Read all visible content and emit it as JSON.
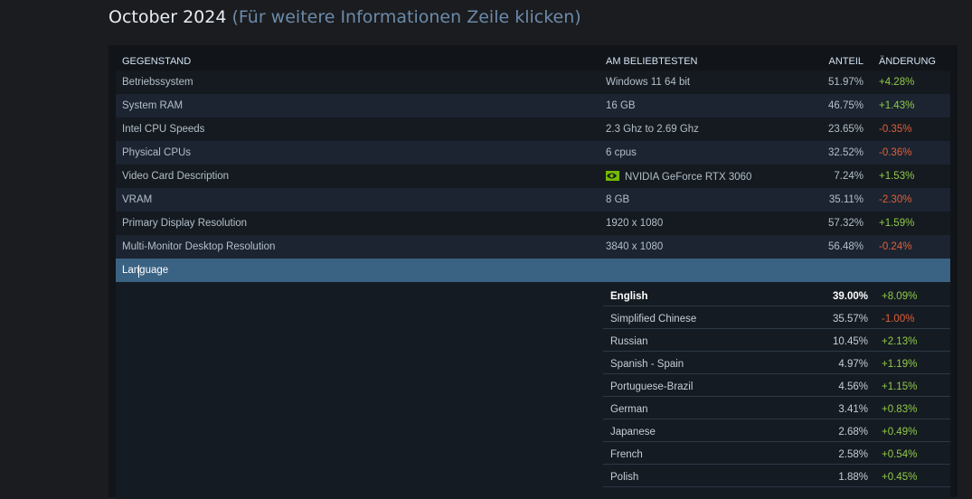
{
  "page": {
    "title": "October 2024",
    "hint": "(Für weitere Informationen Zeile klicken)"
  },
  "table": {
    "headers": {
      "item": "GEGENSTAND",
      "popular": "AM BELIEBTESTEN",
      "share": "ANTEIL",
      "change": "ÄNDERUNG"
    },
    "rows": [
      {
        "item": "Betriebssystem",
        "popular": "Windows 11 64 bit",
        "share": "51.97%",
        "change": "+4.28%",
        "trend": "pos"
      },
      {
        "item": "System RAM",
        "popular": "16 GB",
        "share": "46.75%",
        "change": "+1.43%",
        "trend": "pos"
      },
      {
        "item": "Intel CPU Speeds",
        "popular": "2.3 Ghz to 2.69 Ghz",
        "share": "23.65%",
        "change": "-0.35%",
        "trend": "neg"
      },
      {
        "item": "Physical CPUs",
        "popular": "6 cpus",
        "share": "32.52%",
        "change": "-0.36%",
        "trend": "neg"
      },
      {
        "item": "Video Card Description",
        "popular": "NVIDIA GeForce RTX 3060",
        "share": "7.24%",
        "change": "+1.53%",
        "trend": "pos",
        "icon": "nvidia-logo-icon"
      },
      {
        "item": "VRAM",
        "popular": "8 GB",
        "share": "35.11%",
        "change": "-2.30%",
        "trend": "neg"
      },
      {
        "item": "Primary Display Resolution",
        "popular": "1920 x 1080",
        "share": "57.32%",
        "change": "+1.59%",
        "trend": "pos"
      },
      {
        "item": "Multi-Monitor Desktop Resolution",
        "popular": "3840 x 1080",
        "share": "56.48%",
        "change": "-0.24%",
        "trend": "neg"
      }
    ],
    "expanded_row": {
      "item": "Language"
    },
    "languages": [
      {
        "name": "English",
        "share": "39.00%",
        "change": "+8.09%",
        "trend": "pos"
      },
      {
        "name": "Simplified Chinese",
        "share": "35.57%",
        "change": "-1.00%",
        "trend": "neg"
      },
      {
        "name": "Russian",
        "share": "10.45%",
        "change": "+2.13%",
        "trend": "pos"
      },
      {
        "name": "Spanish - Spain",
        "share": "4.97%",
        "change": "+1.19%",
        "trend": "pos"
      },
      {
        "name": "Portuguese-Brazil",
        "share": "4.56%",
        "change": "+1.15%",
        "trend": "pos"
      },
      {
        "name": "German",
        "share": "3.41%",
        "change": "+0.83%",
        "trend": "pos"
      },
      {
        "name": "Japanese",
        "share": "2.68%",
        "change": "+0.49%",
        "trend": "pos"
      },
      {
        "name": "French",
        "share": "2.58%",
        "change": "+0.54%",
        "trend": "pos"
      },
      {
        "name": "Polish",
        "share": "1.88%",
        "change": "+0.45%",
        "trend": "pos"
      }
    ]
  },
  "colors": {
    "positive": "#8fc94a",
    "negative": "#e05f3a",
    "active_row": "#3a6283",
    "hint": "#6b8aaa"
  }
}
